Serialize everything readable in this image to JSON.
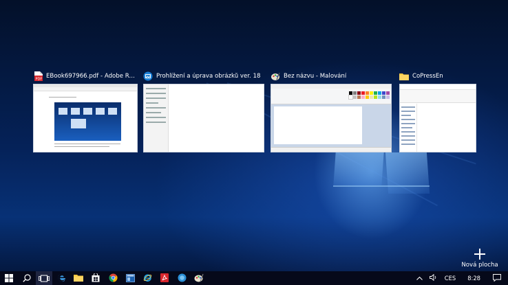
{
  "task_view": {
    "windows": [
      {
        "title": "EBook697966.pdf - Adobe Re...",
        "icon": "acrobat-pdf-icon"
      },
      {
        "title": "Prohlížení a úprava obrázků ver. 18",
        "icon": "image-viewer-icon"
      },
      {
        "title": "Bez názvu - Malování",
        "icon": "paint-icon"
      },
      {
        "title": "CoPressEn",
        "icon": "folder-icon"
      }
    ],
    "new_desktop_label": "Nová plocha"
  },
  "taskbar": {
    "buttons": [
      {
        "name": "start-button",
        "icon": "windows-logo-icon"
      },
      {
        "name": "search-button",
        "icon": "search-icon"
      },
      {
        "name": "task-view-button",
        "icon": "task-view-icon"
      },
      {
        "name": "edge-button",
        "icon": "edge-icon"
      },
      {
        "name": "file-explorer-button",
        "icon": "folder-icon"
      },
      {
        "name": "store-button",
        "icon": "store-icon"
      },
      {
        "name": "chrome-button",
        "icon": "chrome-icon"
      },
      {
        "name": "app-button",
        "icon": "window-app-icon"
      },
      {
        "name": "ie-button",
        "icon": "internet-explorer-icon"
      },
      {
        "name": "acrobat-button",
        "icon": "acrobat-pdf-icon"
      },
      {
        "name": "app-circle-button",
        "icon": "blue-circle-app-icon"
      },
      {
        "name": "paint-button",
        "icon": "paint-icon"
      }
    ],
    "tray": {
      "language": "CES",
      "time": "8:28"
    }
  },
  "colors": {
    "accent": "#1a5fbf",
    "taskbar": "#06091a"
  }
}
